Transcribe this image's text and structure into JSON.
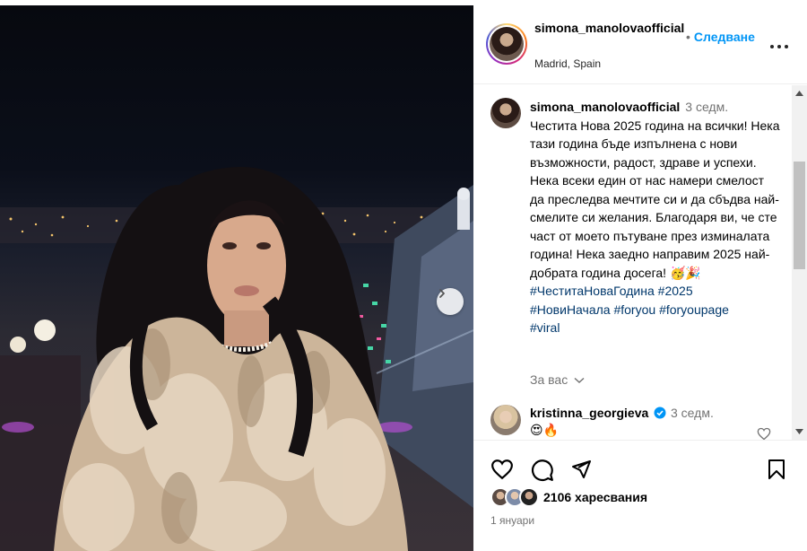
{
  "header": {
    "username": "simona_manolovaofficial",
    "location": "Madrid, Spain",
    "follow_dot": "•",
    "follow_label": "Следване"
  },
  "caption": {
    "username": "simona_manolovaofficial",
    "time": "3 седм.",
    "text": "Честита Нова 2025 година на всички! Нека тази година бъде изпълнена с нови възможности, радост, здраве и успехи. Нека всеки един от нас намери смелост да преследва мечтите си и да сбъдва най-смелите си желания. Благодаря ви, че сте част от моето пътуване през изминалата година! Нека заедно направим 2025 най-добрата година досега! 🥳🎉",
    "hashtags": [
      "#ЧеститаНоваГодина",
      "#2025",
      "#НовиНачала",
      "#foryou",
      "#foryoupage",
      "#viral"
    ],
    "for_you_label": "За вас"
  },
  "comment": {
    "username": "kristinna_georgieva",
    "time": "3 седм.",
    "text": "😍🔥"
  },
  "actions": {
    "likes": "2106 харесвания",
    "date": "1 януари"
  },
  "colors": {
    "link": "#0095f6",
    "hashtag": "#00376b",
    "muted": "#737373"
  },
  "icons": [
    "heart-icon",
    "comment-icon",
    "share-icon",
    "bookmark-icon",
    "more-icon",
    "chevron-right-icon",
    "verified-icon",
    "chevron-down-icon"
  ]
}
